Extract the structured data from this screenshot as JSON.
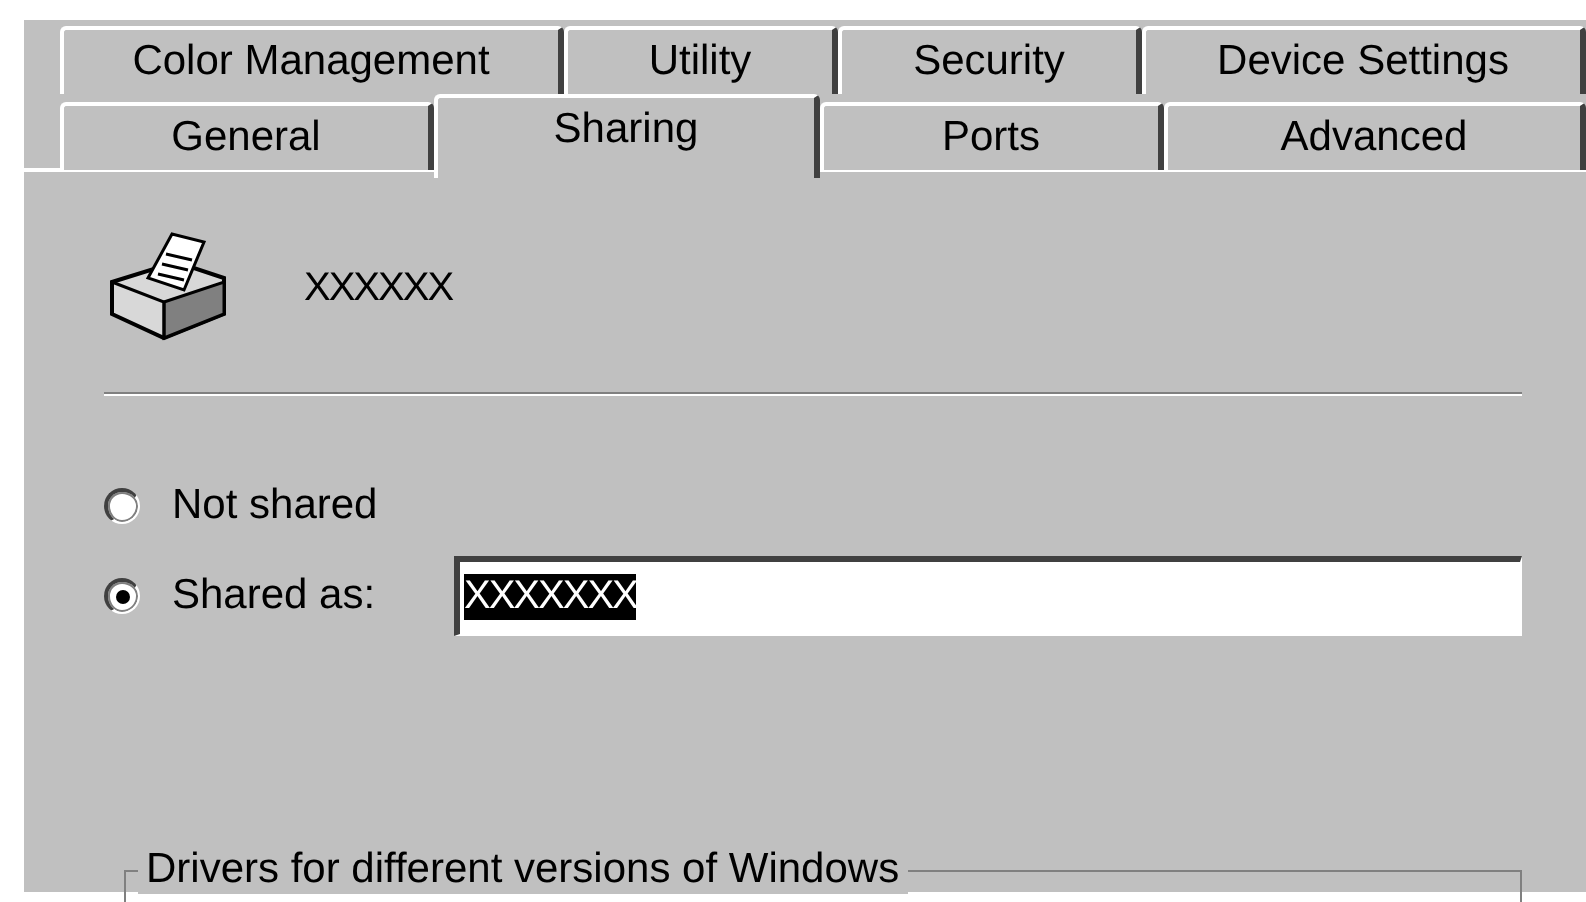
{
  "tab_rows": [
    {
      "tabs": [
        {
          "label": "Color Management",
          "selected": false
        },
        {
          "label": "Utility",
          "selected": false
        },
        {
          "label": "Security",
          "selected": false
        },
        {
          "label": "Device Settings",
          "selected": false
        }
      ]
    },
    {
      "tabs": [
        {
          "label": "General",
          "selected": false
        },
        {
          "label": "Sharing",
          "selected": true
        },
        {
          "label": "Ports",
          "selected": false
        },
        {
          "label": "Advanced",
          "selected": false
        }
      ]
    }
  ],
  "printer": {
    "name": "XXXXXX"
  },
  "options": [
    {
      "label": "Not shared",
      "selected": false
    },
    {
      "label": "Shared as:",
      "selected": true
    }
  ],
  "share_name": {
    "value": "XXXXXXX",
    "highlighted": true
  },
  "group": {
    "title": "Drivers for different versions of Windows"
  }
}
